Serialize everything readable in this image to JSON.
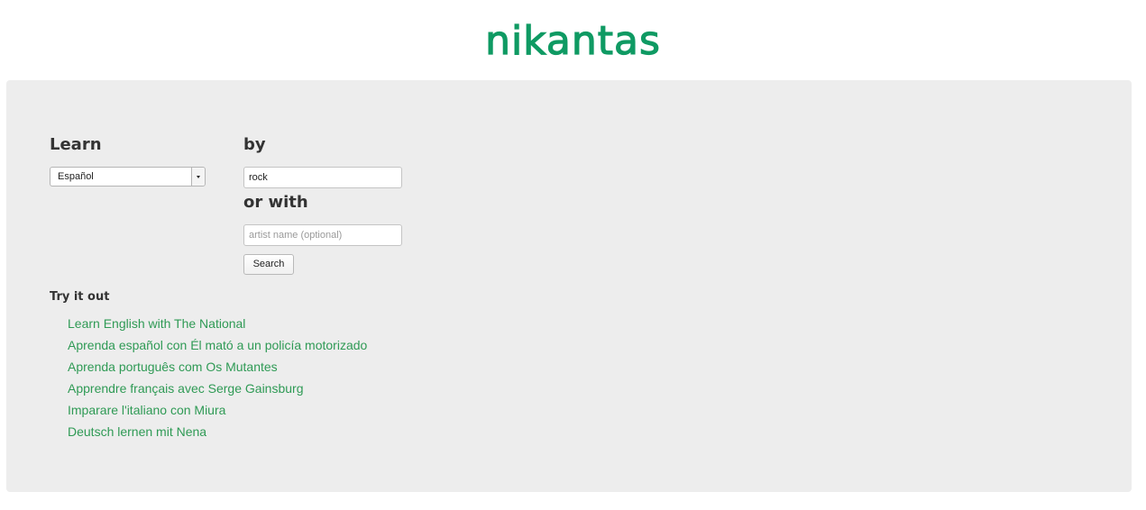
{
  "brand": {
    "logo_text": "nikantas",
    "color": "#0f9a63"
  },
  "form": {
    "learn_label": "Learn",
    "language_selected": "Español",
    "by_label": "by",
    "genre_value": "rock",
    "or_with_label": "or with",
    "artist_placeholder": "artist name (optional)",
    "search_button": "Search"
  },
  "try_it_out": {
    "title": "Try it out",
    "link_color": "#2f9a55",
    "links": [
      "Learn English with The National",
      "Aprenda español con Él mató a un policía motorizado",
      "Aprenda português com Os Mutantes",
      "Apprendre français avec Serge Gainsburg",
      "Imparare l'italiano con Miura",
      "Deutsch lernen mit Nena"
    ]
  }
}
